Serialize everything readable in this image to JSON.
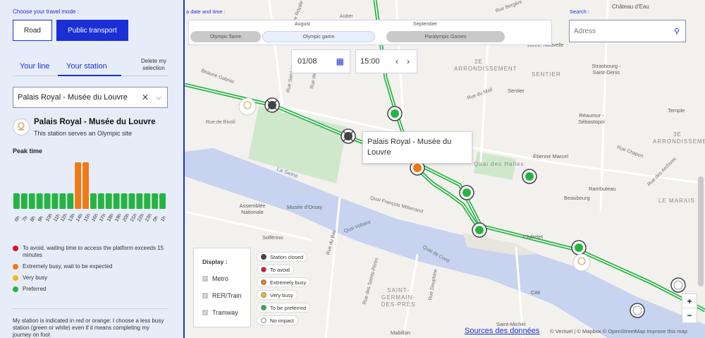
{
  "panel": {
    "travel_mode_label": "Choose your travel mode :",
    "mode_road": "Road",
    "mode_public_transport": "Public transport",
    "tab_line": "Your line",
    "tab_station": "Your station",
    "delete_selection": "Delete my selection",
    "station_select_value": "Palais Royal - Musée du Louvre",
    "station_title": "Palais Royal - Musée du Louvre",
    "station_subtitle": "This station serves an Olympic site",
    "peak_time_title": "Peak time",
    "legend": [
      {
        "color": "#e0102a",
        "text": "To avoid, waiting time to access the platform exceeds 15 minutes"
      },
      {
        "color": "#f07a14",
        "text": "Extremely busy, wait to be expected"
      },
      {
        "color": "#f2b714",
        "text": "Very busy"
      },
      {
        "color": "#27b343",
        "text": "Preferred"
      }
    ],
    "hint": "My station is indicated in red or orange: I choose a less busy station (green or white) even if it means completing my journey on foot"
  },
  "chart_data": {
    "type": "bar",
    "title": "Peak time",
    "categories": [
      "6h",
      "7h",
      "8h",
      "9h",
      "10h",
      "11h",
      "12h",
      "13h",
      "14h",
      "15h",
      "16h",
      "17h",
      "18h",
      "19h",
      "20h",
      "21h",
      "22h",
      "23h",
      "0h",
      "1h"
    ],
    "values": [
      1,
      1,
      1,
      1,
      1,
      1,
      1,
      1,
      3,
      3,
      1,
      1,
      1,
      1,
      1,
      1,
      1,
      1,
      1,
      1
    ],
    "colors": [
      "#27b343",
      "#27b343",
      "#27b343",
      "#27b343",
      "#27b343",
      "#27b343",
      "#27b343",
      "#27b343",
      "#f07a14",
      "#f07a14",
      "#27b343",
      "#27b343",
      "#27b343",
      "#27b343",
      "#27b343",
      "#27b343",
      "#27b343",
      "#27b343",
      "#27b343",
      "#27b343"
    ],
    "xlabel": "",
    "ylabel": "",
    "grid": false
  },
  "controls": {
    "date_time_label": "a date and time :",
    "months": [
      "August",
      "September"
    ],
    "periods": [
      "Olympic flame",
      "Olympic game",
      "Paralympic Games"
    ],
    "date_value": "01/08",
    "time_value": "15:00",
    "search_label": "Search :",
    "search_placeholder": "Adress"
  },
  "tooltip": "Palais Royal - Musée du Louvre",
  "display": {
    "title": "Display :",
    "options": [
      "Metro",
      "RER/Train",
      "Tramway"
    ]
  },
  "map_legend": [
    {
      "type": "closed",
      "text": "Station closed"
    },
    {
      "color": "#e0102a",
      "text": "To avoid"
    },
    {
      "color": "#f07a14",
      "text": "Extremely busy"
    },
    {
      "color": "#f2b714",
      "text": "Very busy"
    },
    {
      "color": "#27b343",
      "text": "To be preferred"
    },
    {
      "color": "#ffffff",
      "text": "No impact"
    }
  ],
  "map": {
    "streets": [
      "Rue Saint-Honoré",
      "Auber",
      "Rue Bergère",
      "Château d'Eau",
      "Jonne Nouvelle",
      "Strasbourg - Saint-Denis",
      "Sentier",
      "Réaumur - Sébastopol",
      "Temple",
      "Étienne Marcel",
      "Rambuteau",
      "Beaubourg",
      "Le Marais",
      "Châtelet",
      "Cité",
      "Saint-Michel",
      "Mabillon",
      "Solférino",
      "Musée d'Orsay",
      "Assemblée Nationale",
      "La Seine",
      "Quai François Mitterrand",
      "Quai Voltaire",
      "Quai de Conti",
      "Rue du Bac",
      "Rue des Saints-Pères",
      "Rue Dauphine",
      "Rue du Mail",
      "Rue Chapon",
      "Rue des Archives",
      "Rue de Rivoli",
      "Rue Royale",
      "Beaune Gabriel",
      "Rue de la Paix",
      "Quai des Halles"
    ],
    "districts": [
      "2E ARRONDISSEMENT",
      "SENTIER",
      "3E ARRONDISSEMENT",
      "QUARTIER DES HALLES",
      "LE MARAIS",
      "SAINT-GERMAIN-DES-PRÉS"
    ],
    "sources_link": "Sources des données",
    "attribution": "© Vectuel | © Mapbox © OpenStreetMap Improve this map",
    "zoom_in": "+",
    "zoom_out": "−"
  }
}
